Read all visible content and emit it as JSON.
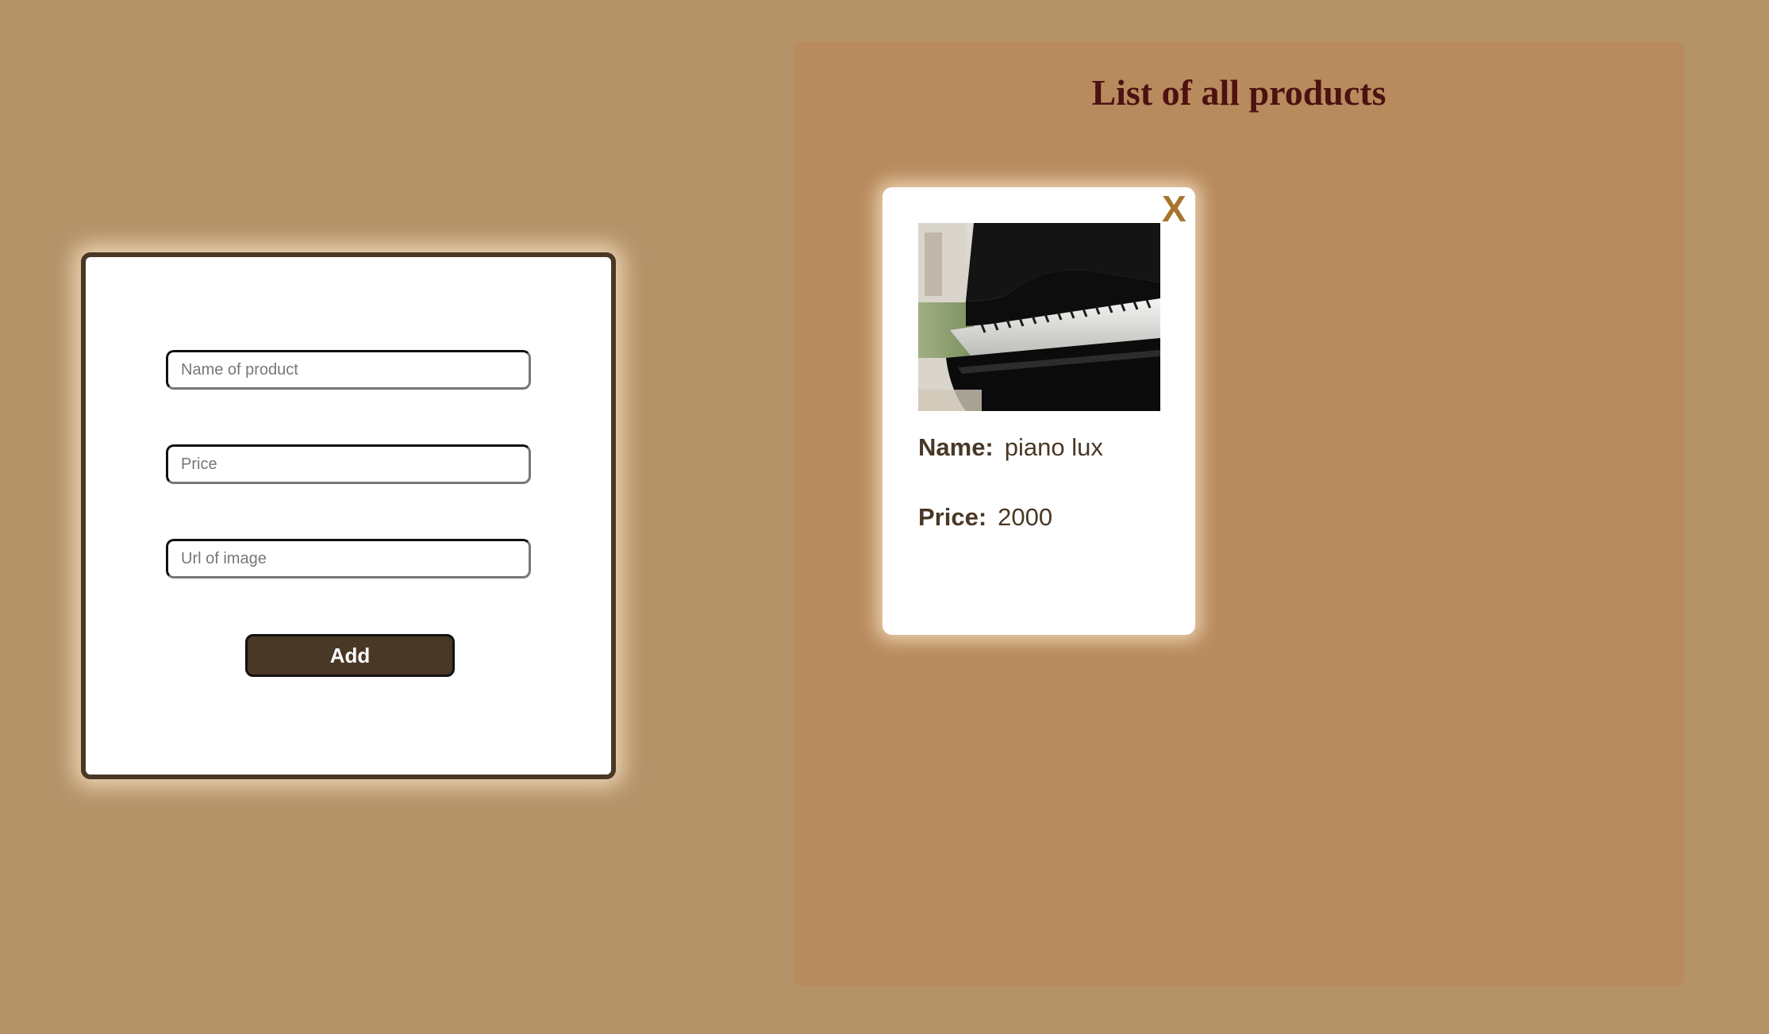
{
  "form": {
    "name_placeholder": "Name of product",
    "price_placeholder": "Price",
    "url_placeholder": "Url of image",
    "add_label": "Add"
  },
  "list": {
    "title": "List of all products",
    "products": [
      {
        "close_label": "X",
        "name_label": "Name:",
        "name": "piano lux",
        "price_label": "Price:",
        "price": "2000",
        "image": "grand-piano-photo"
      }
    ]
  },
  "colors": {
    "page_background": "#b59369",
    "panel_background": "#b88b5e",
    "title_text": "#4d1111",
    "dark_brown": "#493826",
    "close_accent": "#a7752d"
  }
}
